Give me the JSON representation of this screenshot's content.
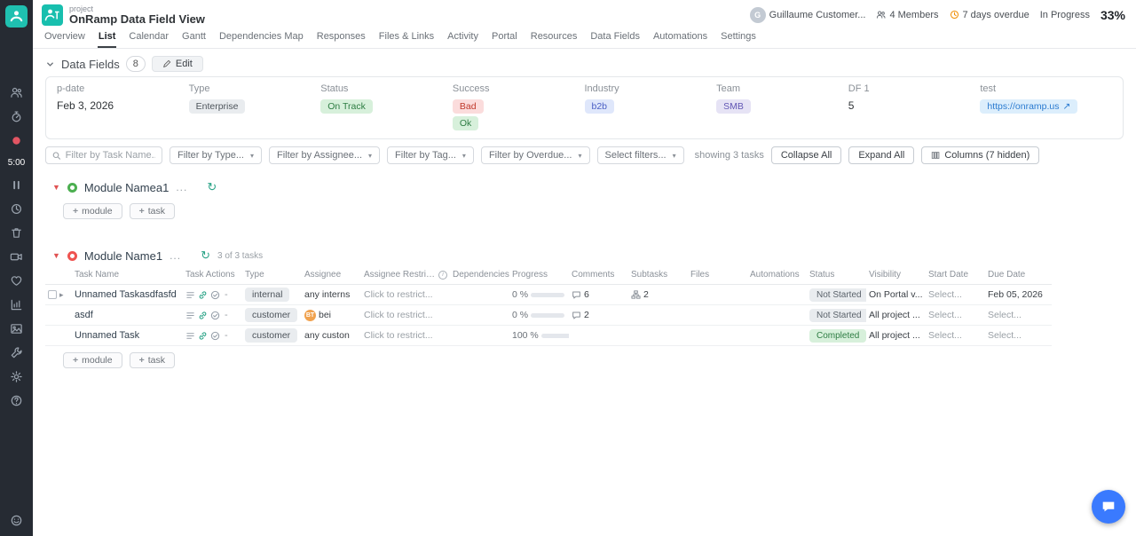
{
  "header": {
    "project_label": "project",
    "title": "OnRamp Data Field View",
    "user": "Guillaume Customer...",
    "user_initial": "G",
    "members": "4 Members",
    "overdue": "7 days overdue",
    "progress_status": "In Progress",
    "progress_percent": "33%"
  },
  "nav": {
    "tabs": [
      "Overview",
      "List",
      "Calendar",
      "Gantt",
      "Dependencies Map",
      "Responses",
      "Files & Links",
      "Activity",
      "Portal",
      "Resources",
      "Data Fields",
      "Automations",
      "Settings"
    ],
    "active_tab": "List"
  },
  "data_fields": {
    "section_title": "Data Fields",
    "count_badge": "8",
    "edit_label": "Edit",
    "headers": [
      "p-date",
      "Type",
      "Status",
      "Success",
      "Industry",
      "Team",
      "DF 1",
      "test"
    ],
    "row": {
      "p_date": "Feb 3, 2026",
      "type_chip": "Enterprise",
      "status_chip": "On Track",
      "success_bad": "Bad",
      "success_ok": "Ok",
      "industry_chip": "b2b",
      "team_chip": "SMB",
      "df1": "5",
      "test_link": "https://onramp.us"
    }
  },
  "filter_bar": {
    "search_placeholder": "Filter by Task Name...",
    "type_filter": "Filter by Type...",
    "assignee_filter": "Filter by Assignee...",
    "tag_filter": "Filter by Tag...",
    "overdue_filter": "Filter by Overdue...",
    "select_filters": "Select filters...",
    "showing": "showing 3 tasks",
    "collapse_all": "Collapse All",
    "expand_all": "Expand All",
    "columns_button": "Columns (7 hidden)"
  },
  "module1": {
    "name": "Module Namea1",
    "accent": "#4caf50"
  },
  "module2": {
    "name": "Module Name1",
    "tasks_info": "3 of 3 tasks",
    "accent": "#ef5350"
  },
  "add_buttons": {
    "module_label": "module",
    "task_label": "task"
  },
  "task_table": {
    "headers": [
      "Task Name",
      "Task Actions",
      "Type",
      "Assignee",
      "Assignee Restrictions",
      "Dependencies",
      "Progress",
      "Comments",
      "Subtasks",
      "Files",
      "Automations",
      "Status",
      "Visibility",
      "Start Date",
      "Due Date"
    ],
    "rows": [
      {
        "name": "Unnamed Taskasdfasfd",
        "type": "internal",
        "assignee": "any interns",
        "restriction": "Click to restrict...",
        "progress_label": "0 %",
        "progress_percent": 0,
        "comments": "6",
        "subtasks": "2",
        "status": "Not Started",
        "visibility": "On Portal v...",
        "start_date": "Select...",
        "due_date": "Feb 05, 2026"
      },
      {
        "name": "asdf",
        "type": "customer",
        "assignee_avatar": "BT",
        "assignee": "bei",
        "restriction": "Click to restrict...",
        "progress_label": "0 %",
        "progress_percent": 0,
        "comments": "2",
        "status": "Not Started",
        "visibility": "All project ...",
        "start_date": "Select...",
        "due_date": "Select..."
      },
      {
        "name": "Unnamed Task",
        "type": "customer",
        "assignee": "any custon",
        "restriction": "Click to restrict...",
        "progress_label": "100 %",
        "progress_percent": 100,
        "status": "Completed",
        "visibility": "All project ...",
        "start_date": "Select...",
        "due_date": "Select..."
      }
    ]
  },
  "sidebar": {
    "timer": "5:00"
  },
  "icons": {
    "collapse_triangle": "▼",
    "row_expand": "▸",
    "dropdown_caret": "▾",
    "refresh": "↻",
    "more": "...",
    "plus": "+",
    "dash": "-",
    "external_link": "↗",
    "info": "i"
  },
  "colors": {
    "brand_teal": "#1fc0b0",
    "progress_done": "#6c7ae0",
    "progress_zero": "#e05252",
    "status_green": "#2e7d43",
    "fab_blue": "#3a7afe"
  }
}
